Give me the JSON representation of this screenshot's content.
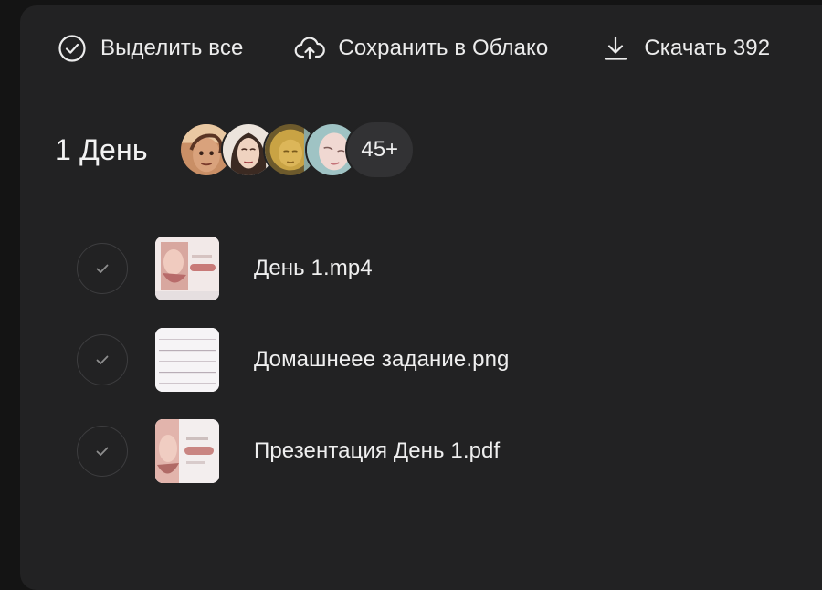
{
  "toolbar": {
    "select_all": {
      "label": "Выделить все",
      "icon": "check-circle-icon"
    },
    "save_cloud": {
      "label": "Сохранить в Облако",
      "icon": "cloud-upload-icon"
    },
    "download": {
      "label": "Скачать 392",
      "icon": "download-icon"
    }
  },
  "section": {
    "title": "1 День",
    "participants_more": "45+"
  },
  "files": [
    {
      "name": "День 1.mp4",
      "thumb": "video-thumbnail"
    },
    {
      "name": "Домашнеее задание.png",
      "thumb": "image-thumbnail"
    },
    {
      "name": "Презентация День 1.pdf",
      "thumb": "pdf-thumbnail"
    }
  ],
  "colors": {
    "background": "#141414",
    "panel": "#222223",
    "text": "#ececec",
    "chip": "#323234"
  }
}
